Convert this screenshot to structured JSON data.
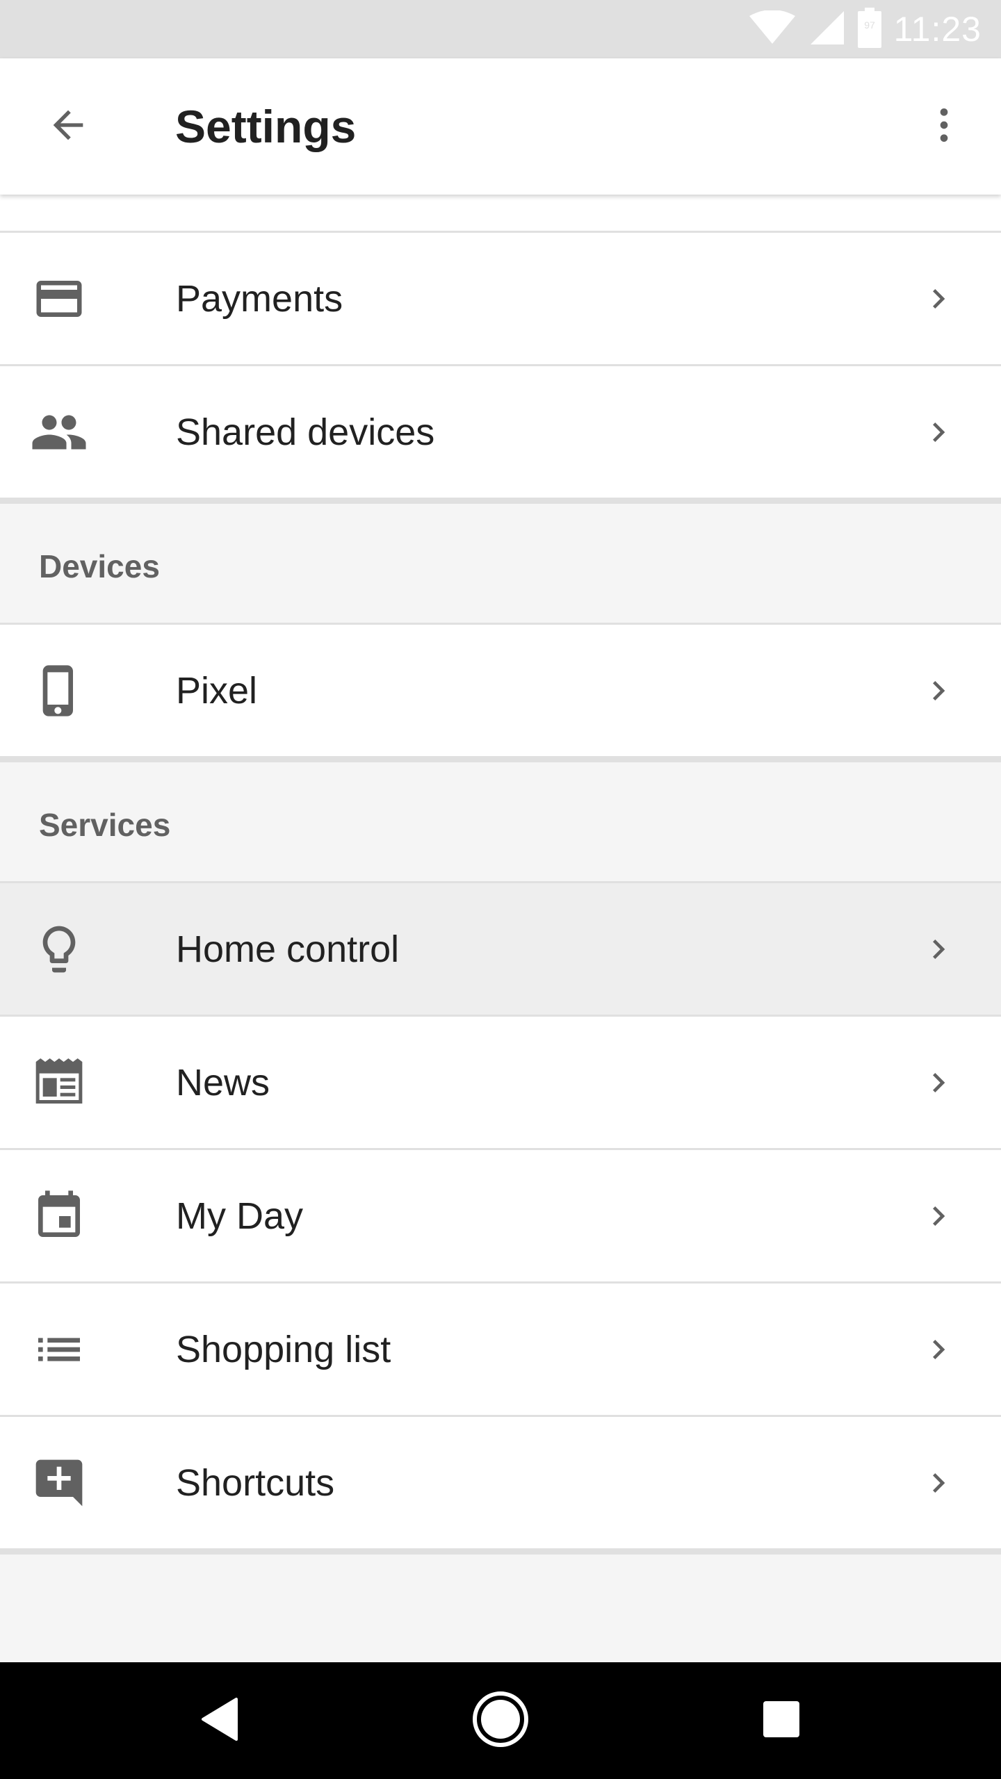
{
  "status_bar": {
    "time": "11:23",
    "battery_level": "97",
    "icons": [
      "wifi-icon",
      "signal-icon",
      "battery-icon"
    ]
  },
  "app_bar": {
    "title": "Settings",
    "back_icon": "arrow-back-icon",
    "overflow_icon": "more-vert-icon"
  },
  "account_items": [
    {
      "label": "Payments",
      "icon": "credit-card-icon"
    },
    {
      "label": "Shared devices",
      "icon": "people-icon"
    }
  ],
  "devices_section": {
    "header": "Devices",
    "items": [
      {
        "label": "Pixel",
        "icon": "phone-icon"
      }
    ]
  },
  "services_section": {
    "header": "Services",
    "items": [
      {
        "label": "Home control",
        "icon": "lightbulb-icon",
        "highlighted": true
      },
      {
        "label": "News",
        "icon": "newspaper-icon"
      },
      {
        "label": "My Day",
        "icon": "calendar-icon"
      },
      {
        "label": "Shopping list",
        "icon": "list-icon"
      },
      {
        "label": "Shortcuts",
        "icon": "add-comment-icon"
      }
    ]
  },
  "nav_bar": {
    "buttons": [
      "back-triangle-icon",
      "home-circle-icon",
      "recents-square-icon"
    ]
  },
  "colors": {
    "status_bar_bg": "#e0e0e0",
    "app_bar_bg": "#ffffff",
    "list_bg": "#ffffff",
    "section_bg": "#f5f5f5",
    "divider": "#e0e0e0",
    "highlight_bg": "#eeeeee",
    "text_primary": "#212121",
    "text_section": "#616161",
    "icon": "#616161",
    "nav_bar_bg": "#000000"
  }
}
